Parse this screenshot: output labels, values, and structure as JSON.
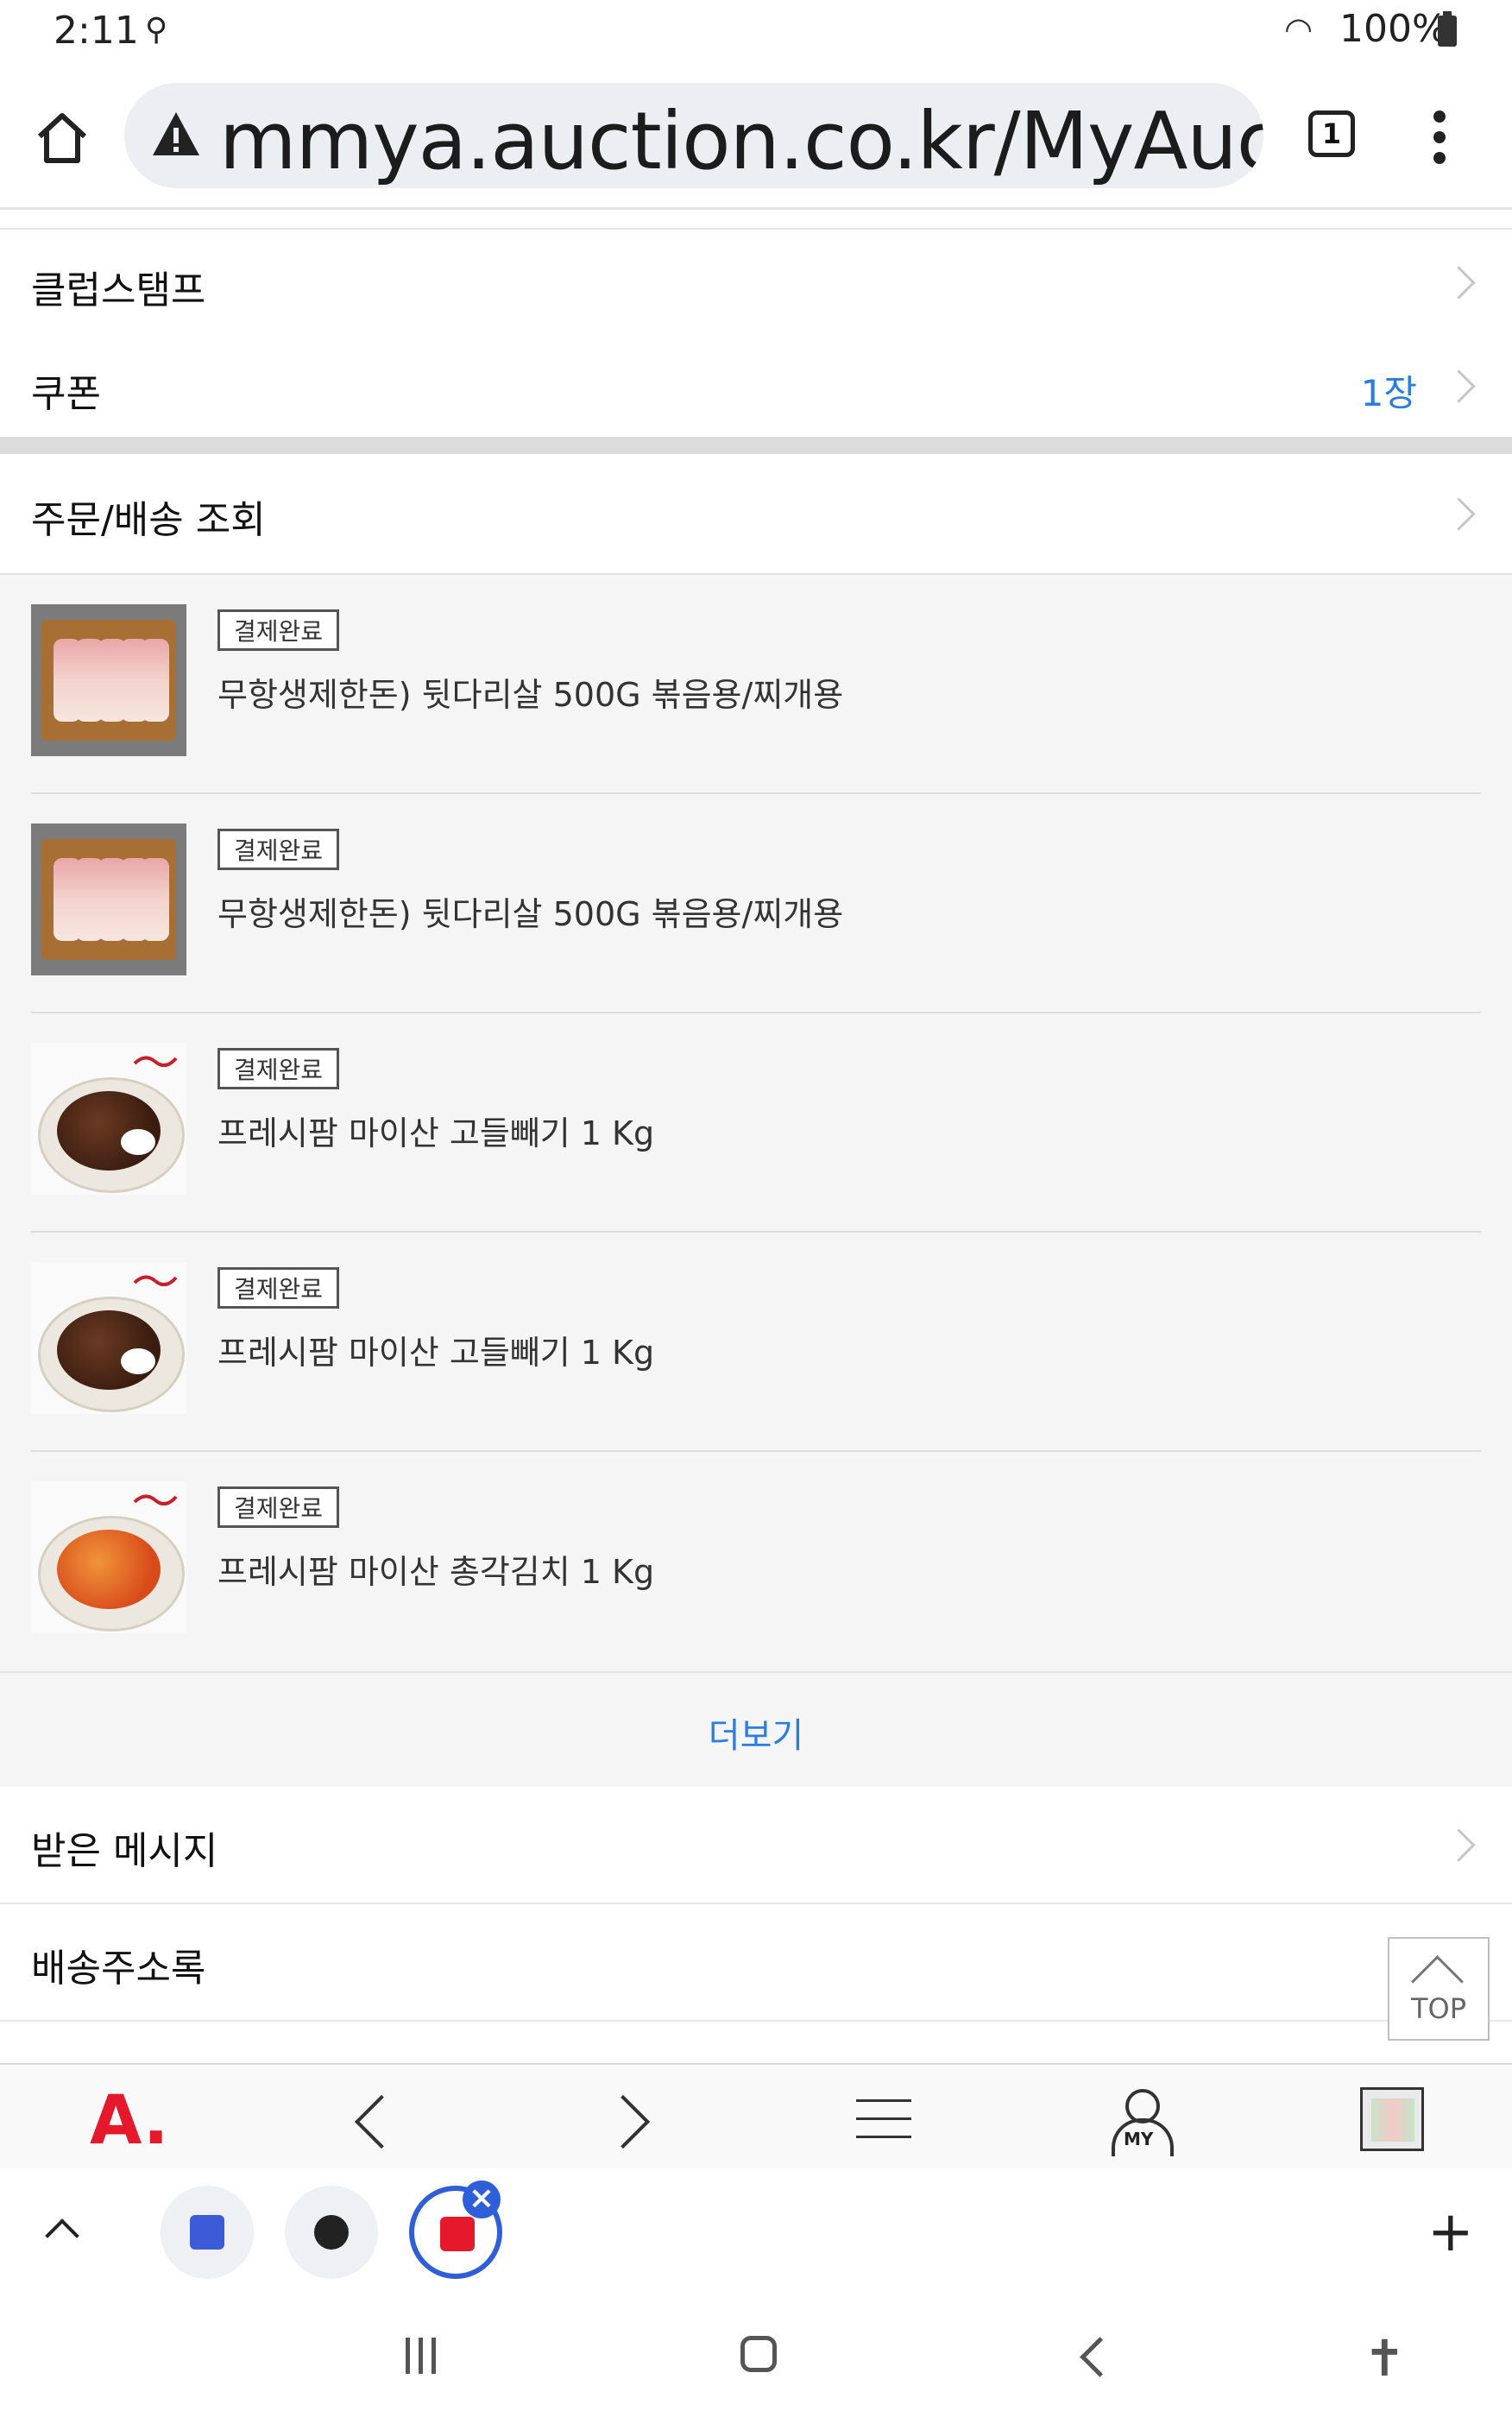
{
  "status_bar": {
    "time": "2:11",
    "battery": "100%"
  },
  "browser": {
    "url": "mmya.auction.co.kr/MyAuct",
    "tab_count": "1"
  },
  "menu": {
    "club_stamp": "클럽스탬프",
    "coupon": "쿠폰",
    "coupon_count": "1장",
    "order_lookup": "주문/배송 조회"
  },
  "orders": [
    {
      "status": "결제완료",
      "name": "무항생제한돈) 뒷다리살 500G 볶음용/찌개용"
    },
    {
      "status": "결제완료",
      "name": "무항생제한돈) 뒷다리살 500G 볶음용/찌개용"
    },
    {
      "status": "결제완료",
      "name": "프레시팜 마이산 고들빼기 1 Kg"
    },
    {
      "status": "결제완료",
      "name": "프레시팜 마이산 고들빼기 1 Kg"
    },
    {
      "status": "결제완료",
      "name": "프레시팜 마이산 총각김치 1 Kg"
    }
  ],
  "more_label": "더보기",
  "menu2": {
    "messages": "받은 메시지",
    "address_book": "배송주소록"
  },
  "top_button": "TOP",
  "site_nav": {
    "logo": "A.",
    "my_label": "MY"
  },
  "colors": {
    "accent_blue": "#2a7de1",
    "brand_red": "#e5192b"
  }
}
